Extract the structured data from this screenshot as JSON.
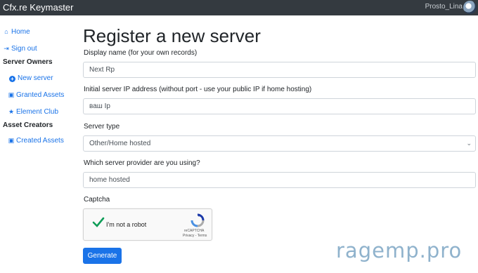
{
  "topbar": {
    "brand": "Cfx.re Keymaster",
    "username": "Prosto_Lina"
  },
  "sidebar": {
    "home": {
      "icon": "home-icon",
      "label": "Home"
    },
    "sign_out": {
      "icon": "sign-out-icon",
      "label": "Sign out"
    },
    "section_owners": "Server Owners",
    "new_server": {
      "icon": "plus-circle-icon",
      "label": "New server"
    },
    "granted_assets": {
      "icon": "gift-icon",
      "label": "Granted Assets"
    },
    "element_club": {
      "icon": "star-icon",
      "label": "Element Club"
    },
    "section_creators": "Asset Creators",
    "created_assets": {
      "icon": "gift-icon",
      "label": "Created Assets"
    }
  },
  "form": {
    "title": "Register a new server",
    "display_name_label": "Display name (for your own records)",
    "display_name_value": "Next Rp",
    "ip_label": "Initial server IP address (without port - use your public IP if home hosting)",
    "ip_value": "ваш Ip",
    "server_type_label": "Server type",
    "server_type_value": "Other/Home hosted",
    "provider_label": "Which server provider are you using?",
    "provider_value": "home hosted",
    "captcha_label": "Captcha",
    "captcha": {
      "checkbox_text": "I'm not a robot",
      "brand": "reCAPTCHA",
      "links": "Privacy - Terms",
      "checked": true
    },
    "submit_label": "Generate"
  },
  "watermark": "ragemp.pro",
  "colors": {
    "topbar": "#343a40",
    "primary": "#1a73e8",
    "check": "#0f9d58"
  }
}
